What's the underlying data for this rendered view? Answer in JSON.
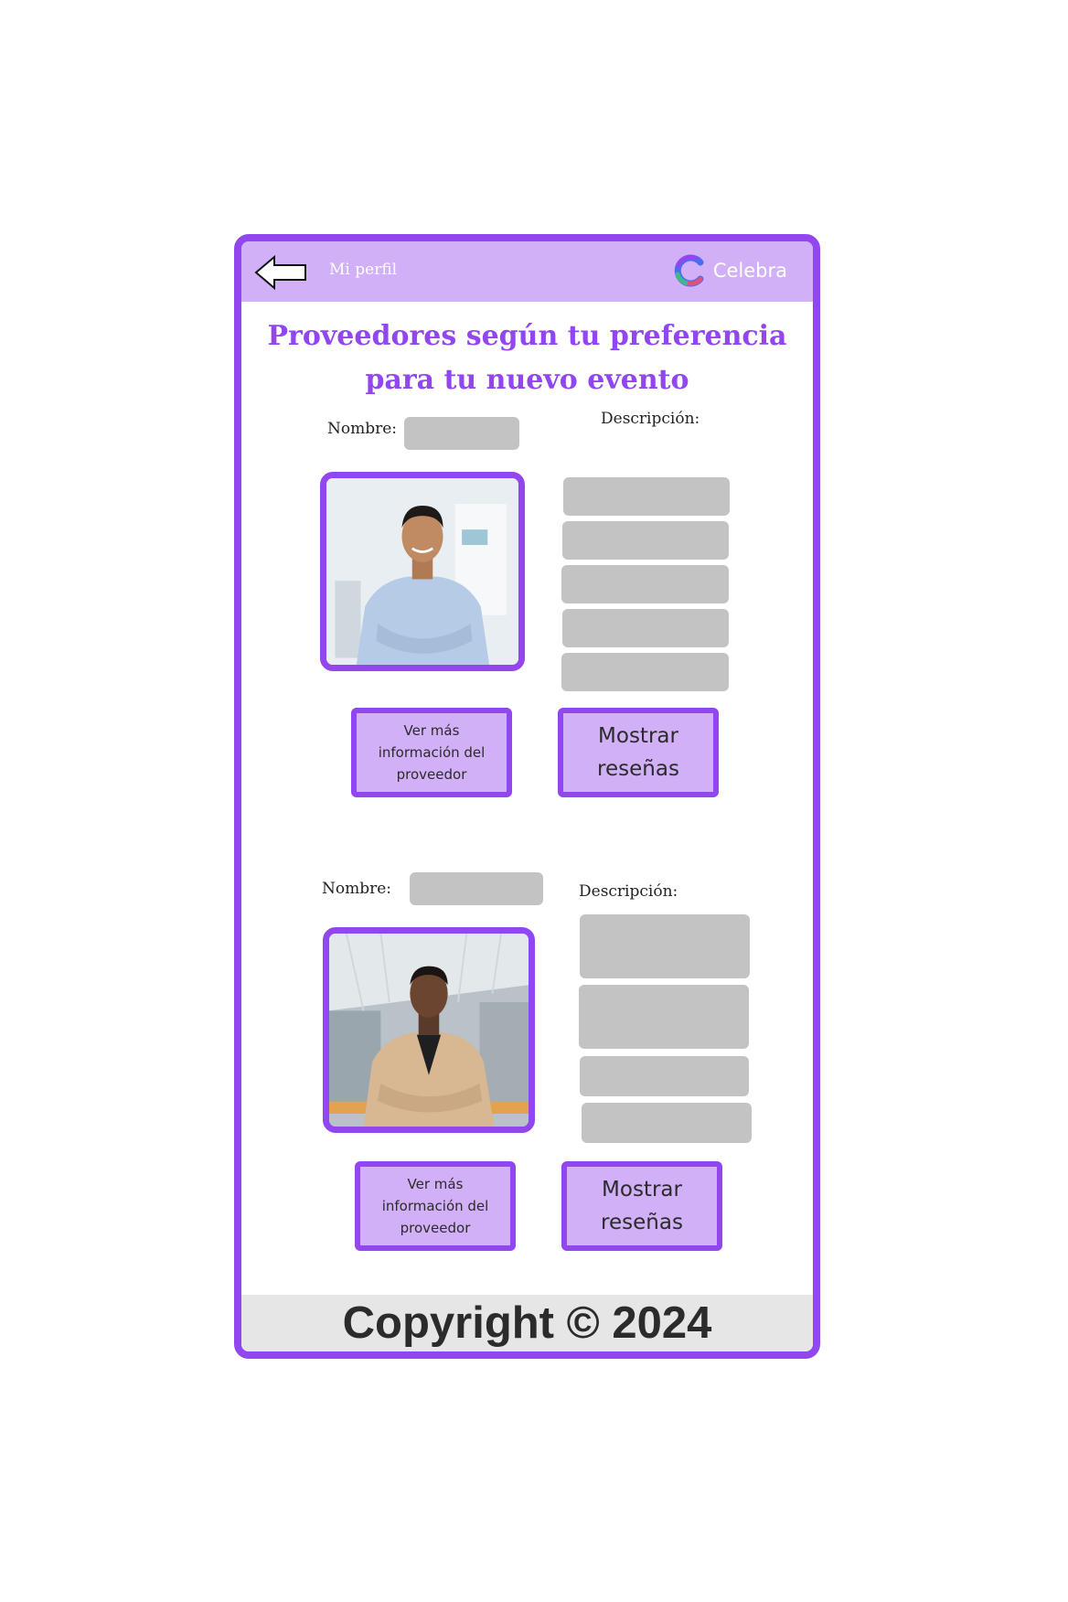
{
  "header": {
    "back_icon": "arrow-left-icon",
    "profile_link": "Mi perfil",
    "brand_name": "Celebra",
    "brand_logo": "celebra-logo-icon"
  },
  "page_title": "Proveedores según tu preferencia para tu nuevo evento",
  "providers": [
    {
      "name_label": "Nombre:",
      "description_label": "Descripción:",
      "info_button": "Ver más información del proveedor",
      "reviews_button": "Mostrar reseñas"
    },
    {
      "name_label": "Nombre:",
      "description_label": "Descripción:",
      "info_button": "Ver más información del proveedor",
      "reviews_button": "Mostrar reseñas"
    }
  ],
  "footer": {
    "copyright": "Copyright © 2024"
  },
  "colors": {
    "accent": "#9146f0",
    "accent_light": "#d1b0f7",
    "placeholder": "#c3c3c3",
    "footer_bg": "#e6e6e6"
  }
}
